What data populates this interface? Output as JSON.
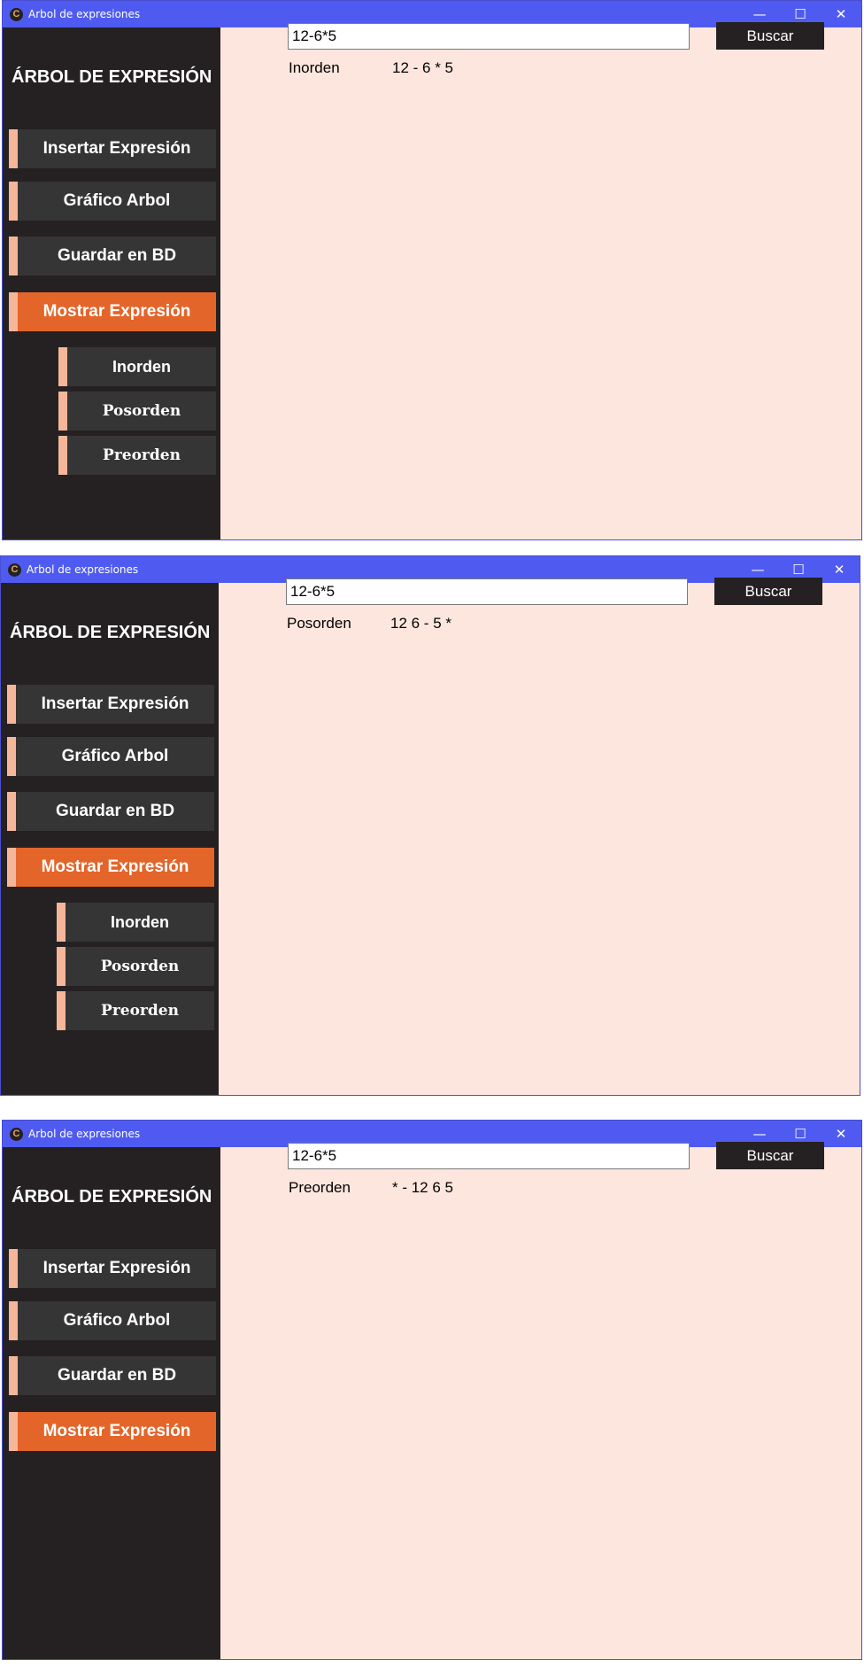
{
  "windows": [
    {
      "title": "Arbol de expresiones",
      "app_icon": "C",
      "window_controls": {
        "minimize": "—",
        "maximize": "☐",
        "close": "✕"
      },
      "brand": "ÁRBOL DE EXPRESIÓN",
      "menu": [
        "Insertar Expresión",
        "Gráfico Arbol",
        "Guardar en BD",
        "Mostrar Expresión"
      ],
      "active_menu": "Mostrar Expresión",
      "submenu": [
        "Inorden",
        "Posorden",
        "Preorden"
      ],
      "input_value": "12-6*5",
      "search_label": "Buscar",
      "result_label": "Inorden",
      "result_value": "12 - 6 * 5"
    },
    {
      "title": "Arbol de expresiones",
      "app_icon": "C",
      "window_controls": {
        "minimize": "—",
        "maximize": "☐",
        "close": "✕"
      },
      "brand": "ÁRBOL DE EXPRESIÓN",
      "menu": [
        "Insertar Expresión",
        "Gráfico Arbol",
        "Guardar en BD",
        "Mostrar Expresión"
      ],
      "active_menu": "Mostrar Expresión",
      "submenu": [
        "Inorden",
        "Posorden",
        "Preorden"
      ],
      "input_value": "12-6*5",
      "search_label": "Buscar",
      "result_label": "Posorden",
      "result_value": "12 6 - 5 *"
    },
    {
      "title": "Arbol de expresiones",
      "app_icon": "C",
      "window_controls": {
        "minimize": "—",
        "maximize": "☐",
        "close": "✕"
      },
      "brand": "ÁRBOL DE EXPRESIÓN",
      "menu": [
        "Insertar Expresión",
        "Gráfico Arbol",
        "Guardar en BD",
        "Mostrar Expresión"
      ],
      "active_menu": "Mostrar Expresión",
      "submenu": [],
      "input_value": "12-6*5",
      "search_label": "Buscar",
      "result_label": "Preorden",
      "result_value": "* - 12 6 5"
    }
  ],
  "colors": {
    "titlebar": "#4f5bf0",
    "sidebar": "#252122",
    "button": "#353535",
    "active": "#e4652a",
    "accent": "#f6b69a",
    "content": "#fde6de"
  }
}
